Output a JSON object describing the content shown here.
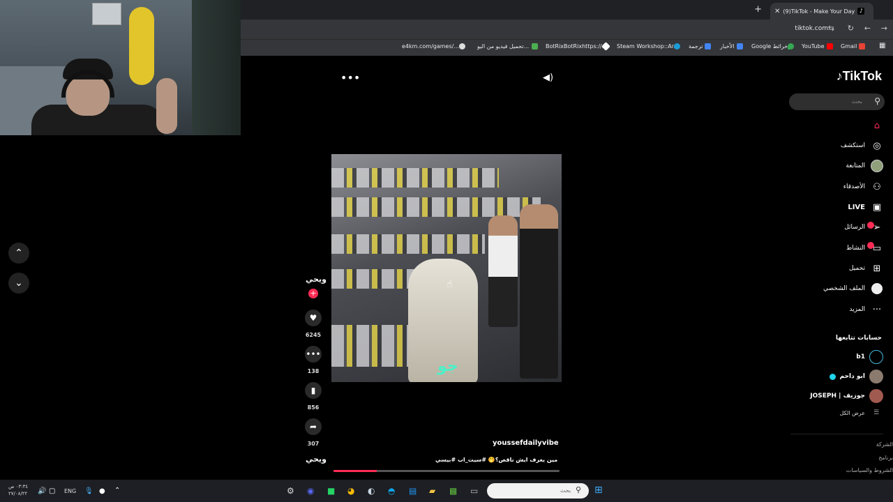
{
  "browser": {
    "tab_title": "(9)TikTok - Make Your Day",
    "url": "tiktok.com",
    "new_tab_glyph": "+",
    "bookmarks": [
      {
        "label": "e4km.com/games/...",
        "color": "#dddddd"
      },
      {
        "label": "تحميل فيديو من اليو...",
        "color": "#4caf50"
      },
      {
        "label": "BotRixBotRixhttps://...",
        "color": "#ffffff"
      },
      {
        "label": "Steam Workshop::Ar...",
        "color": "#1b9cd8"
      },
      {
        "label": "ترجمة",
        "color": "#4285f4"
      },
      {
        "label": "الأخبار",
        "color": "#4285f4"
      },
      {
        "label": "Google خرائط",
        "color": "#34a853"
      },
      {
        "label": "YouTube",
        "color": "#ff0000"
      },
      {
        "label": "Gmail",
        "color": "#ea4335"
      }
    ]
  },
  "tiktok": {
    "logo": "TikTok",
    "search_placeholder": "بحث",
    "nav": [
      {
        "label": "",
        "icon": "home-icon",
        "glyph": "⌂",
        "active": true
      },
      {
        "label": "استكشف",
        "icon": "compass-icon",
        "glyph": "◎"
      },
      {
        "label": "المتابعة",
        "icon": "following-avatar-icon",
        "glyph": "●"
      },
      {
        "label": "الأصدقاء",
        "icon": "friends-icon",
        "glyph": "👥"
      },
      {
        "label": "LIVE",
        "icon": "live-icon",
        "glyph": "▣"
      },
      {
        "label": "الرسائل",
        "icon": "messages-icon",
        "glyph": "➢"
      },
      {
        "label": "النشاط",
        "icon": "activity-icon",
        "glyph": "▭"
      },
      {
        "label": "تحميل",
        "icon": "upload-icon",
        "glyph": "⊞"
      },
      {
        "label": "الملف الشخصي",
        "icon": "profile-icon",
        "glyph": "●"
      },
      {
        "label": "المزيد",
        "icon": "more-icon",
        "glyph": "···"
      }
    ],
    "following_title": "حسابات تتابعها",
    "following": [
      {
        "name": "b1"
      },
      {
        "name": "ابو داحم"
      },
      {
        "name": "JOSEPH | جوزيف"
      }
    ],
    "see_all": "عرض الكل",
    "footer": [
      "الشركة",
      "برنامج",
      "الشروط والسياسات"
    ]
  },
  "video": {
    "creator_mark": "ويحي",
    "likes": "6245",
    "comments": "138",
    "saves": "856",
    "shares": "307",
    "sound_mark": "ويحي",
    "username": "youssefdailyvibe",
    "caption": "مين يعرف ايش ناقص؟🤭 #سيت_اب #بيسي",
    "overlay_text": "جو",
    "progress": 0.19
  },
  "taskbar": {
    "time": "٠٣:٣٤ ص",
    "date": "٢٧/٠٨/٢٢",
    "language": "ENG",
    "search_placeholder": "بحث"
  }
}
